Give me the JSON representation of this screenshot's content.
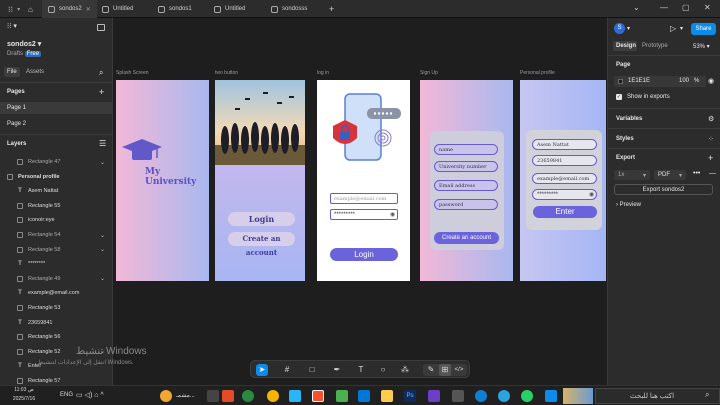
{
  "tabs": [
    {
      "label": "sondos2"
    },
    {
      "label": "Untitled"
    },
    {
      "label": "sondos1"
    },
    {
      "label": "Untitled"
    },
    {
      "label": "sondosss"
    }
  ],
  "left_panel": {
    "project": "sondos2",
    "drafts": "Drafts",
    "plan": "Free",
    "file_tab": "File",
    "assets_tab": "Assets",
    "pages_header": "Pages",
    "pages": [
      "Page 1",
      "Page 2"
    ],
    "layers_header": "Layers",
    "layers": [
      "Rectangle 47",
      "Personal profile",
      "Asem Nattat",
      "Rectangle 55",
      "iconoir:eye",
      "Rectangle 54",
      "Rectangle 58",
      "********",
      "Rectangle 49",
      "example@email.com",
      "Rectangle 53",
      "23659841",
      "Rectangle 56",
      "Rectangle 52",
      "Enter",
      "Rectangle 57"
    ]
  },
  "canvas": {
    "frames": [
      {
        "label": "Splash Screen",
        "title1": "My",
        "title2": "University"
      },
      {
        "label": "two button",
        "btn1": "Login",
        "btn2": "Create an account"
      },
      {
        "label": "log in",
        "email_ph": "example@email.com",
        "pwd": "*********",
        "btn": "Login"
      },
      {
        "label": "Sign Up",
        "f1": "name",
        "f2": "University number",
        "f3": "Email address",
        "f4": "password",
        "btn": "Create an account"
      },
      {
        "label": "Personal profile",
        "f1": "Asem Nattat",
        "f2": "23659841",
        "f3": "example@email.com",
        "f4": "*********",
        "btn": "Enter"
      }
    ]
  },
  "right_panel": {
    "avatar": "S",
    "share": "Share",
    "design_tab": "Design",
    "prototype_tab": "Prototype",
    "zoom": "53%",
    "page_header": "Page",
    "page_color": "1E1E1E",
    "page_opacity": "100",
    "pct": "%",
    "show_exports": "Show in exports",
    "variables": "Variables",
    "styles": "Styles",
    "export": "Export",
    "scale": "1x",
    "format": "PDF",
    "export_btn": "Export sondos2",
    "preview": "Preview"
  },
  "watermark": {
    "line1": "تنشيط Windows",
    "line2": "انتقل إلى الإعدادات لتنشيط Windows."
  },
  "taskbar": {
    "time": "11:03 ص",
    "date": "2025/7/16",
    "lang": "ENG",
    "search": "اكتب هنا للبحث",
    "mishmash": "مشمـ..."
  }
}
